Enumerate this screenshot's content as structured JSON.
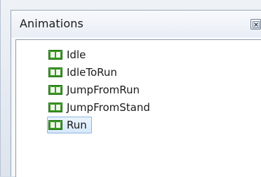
{
  "panel": {
    "title": "Animations"
  },
  "icons": {
    "close": "close-icon",
    "item": "film-clip-icon"
  },
  "colors": {
    "icon_green": "#3a9a22",
    "icon_dark": "#1f6b10",
    "selection": "#d6e8fa",
    "selection_border": "#8fb6e0"
  },
  "list": {
    "items": [
      {
        "label": "Idle"
      },
      {
        "label": "IdleToRun"
      },
      {
        "label": "JumpFromRun"
      },
      {
        "label": "JumpFromStand"
      },
      {
        "label": "Run"
      }
    ],
    "selected_label": "Run"
  }
}
